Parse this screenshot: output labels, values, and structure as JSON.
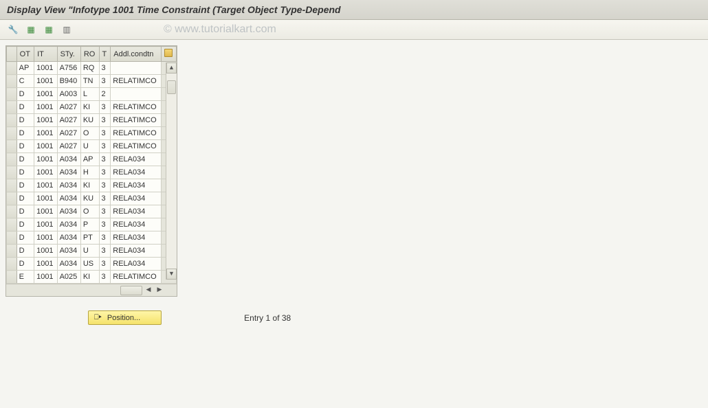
{
  "title": "Display View \"Infotype 1001 Time Constraint (Target Object Type-Depend",
  "watermark": "© www.tutorialkart.com",
  "toolbar": {
    "icons": [
      "glasses-icon",
      "table-icon",
      "table-select-icon",
      "collapse-icon"
    ]
  },
  "table": {
    "headers": {
      "ot": "OT",
      "it": "IT",
      "sty": "STy.",
      "ro": "RO",
      "t": "T",
      "addl": "Addl.condtn"
    },
    "rows": [
      {
        "ot": "AP",
        "it": "1001",
        "sty": "A756",
        "ro": "RQ",
        "t": "3",
        "addl": ""
      },
      {
        "ot": "C",
        "it": "1001",
        "sty": "B940",
        "ro": "TN",
        "t": "3",
        "addl": "RELATIMCO"
      },
      {
        "ot": "D",
        "it": "1001",
        "sty": "A003",
        "ro": "L",
        "t": "2",
        "addl": ""
      },
      {
        "ot": "D",
        "it": "1001",
        "sty": "A027",
        "ro": "KI",
        "t": "3",
        "addl": "RELATIMCO"
      },
      {
        "ot": "D",
        "it": "1001",
        "sty": "A027",
        "ro": "KU",
        "t": "3",
        "addl": "RELATIMCO"
      },
      {
        "ot": "D",
        "it": "1001",
        "sty": "A027",
        "ro": "O",
        "t": "3",
        "addl": "RELATIMCO"
      },
      {
        "ot": "D",
        "it": "1001",
        "sty": "A027",
        "ro": "U",
        "t": "3",
        "addl": "RELATIMCO"
      },
      {
        "ot": "D",
        "it": "1001",
        "sty": "A034",
        "ro": "AP",
        "t": "3",
        "addl": "RELA034"
      },
      {
        "ot": "D",
        "it": "1001",
        "sty": "A034",
        "ro": "H",
        "t": "3",
        "addl": "RELA034"
      },
      {
        "ot": "D",
        "it": "1001",
        "sty": "A034",
        "ro": "KI",
        "t": "3",
        "addl": "RELA034"
      },
      {
        "ot": "D",
        "it": "1001",
        "sty": "A034",
        "ro": "KU",
        "t": "3",
        "addl": "RELA034"
      },
      {
        "ot": "D",
        "it": "1001",
        "sty": "A034",
        "ro": "O",
        "t": "3",
        "addl": "RELA034"
      },
      {
        "ot": "D",
        "it": "1001",
        "sty": "A034",
        "ro": "P",
        "t": "3",
        "addl": "RELA034"
      },
      {
        "ot": "D",
        "it": "1001",
        "sty": "A034",
        "ro": "PT",
        "t": "3",
        "addl": "RELA034"
      },
      {
        "ot": "D",
        "it": "1001",
        "sty": "A034",
        "ro": "U",
        "t": "3",
        "addl": "RELA034"
      },
      {
        "ot": "D",
        "it": "1001",
        "sty": "A034",
        "ro": "US",
        "t": "3",
        "addl": "RELA034"
      },
      {
        "ot": "E",
        "it": "1001",
        "sty": "A025",
        "ro": "KI",
        "t": "3",
        "addl": "RELATIMCO"
      }
    ]
  },
  "position_button": "Position...",
  "entry_info": "Entry 1 of 38"
}
